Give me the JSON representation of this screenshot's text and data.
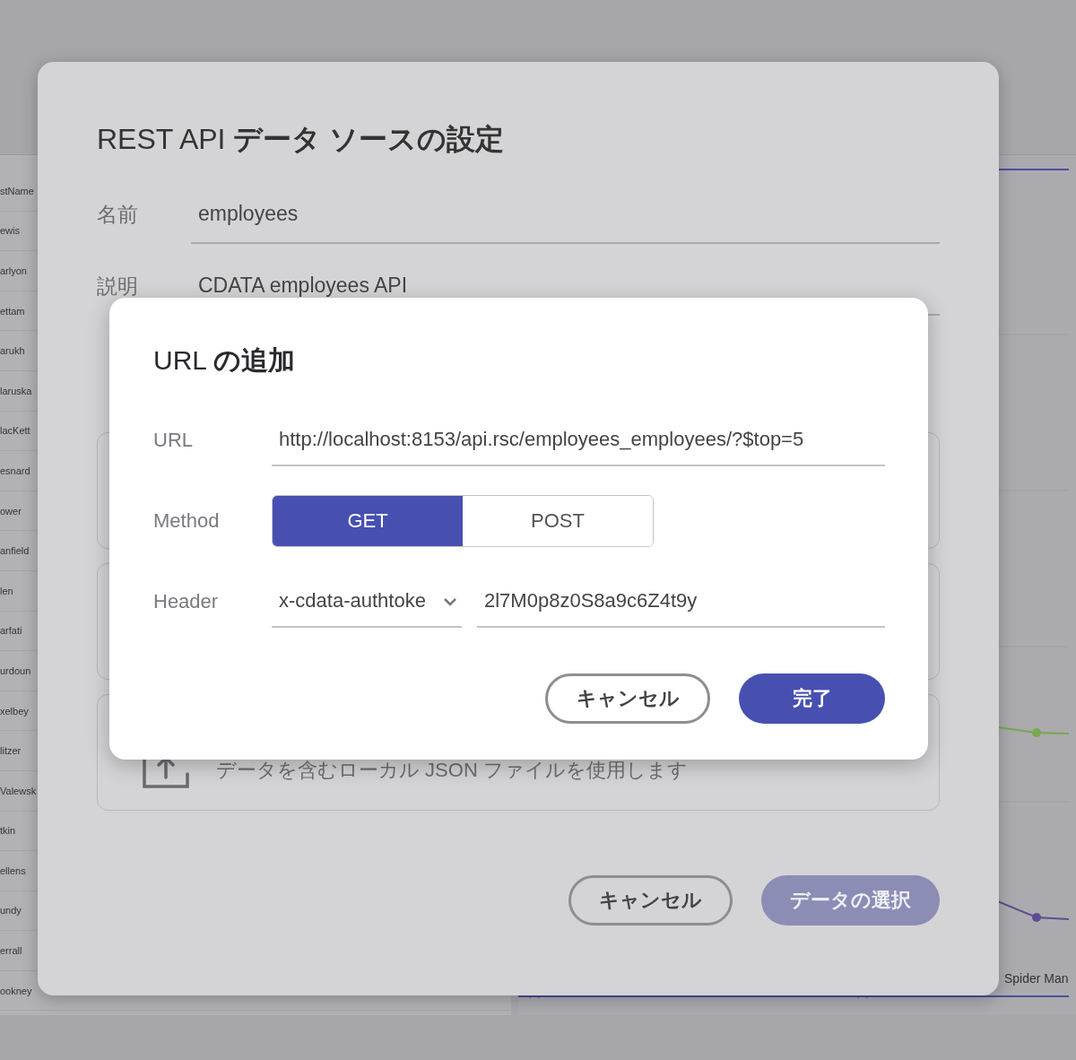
{
  "background_table": {
    "column_header": "stName",
    "rows": [
      "ewis",
      "arlyon",
      "ettam",
      "arukh",
      "laruska",
      "lacKett",
      "esnard",
      "ower",
      "anfield",
      "len",
      "arfati",
      "urdoun",
      "xelbey",
      "litzer",
      "Valewsk",
      "tkin",
      "ellens",
      "undy",
      "errall",
      "ookney"
    ]
  },
  "background_chart": {
    "x_label": "Spider Man"
  },
  "data_source_dialog": {
    "title": "REST API **データ ソースの設定**",
    "fields": [
      {
        "label": "名前",
        "value": "employees"
      },
      {
        "label": "説明",
        "value": "CDATA employees API"
      }
    ],
    "option_cards": [
      {
        "kind": "hidden"
      },
      {
        "kind": "hidden"
      },
      {
        "kind": "upload",
        "text": "データを含むローカル JSON ファイルを使用します"
      }
    ],
    "buttons": [
      {
        "label": "キャンセル",
        "kind": "secondary",
        "disabled": false
      },
      {
        "label": "データの選択",
        "kind": "primary",
        "disabled": true
      }
    ]
  },
  "url_dialog": {
    "title": "URL **の追加**",
    "url": {
      "label": "URL",
      "value": "http://localhost:8153/api.rsc/employees_employees/?$top=5"
    },
    "method": {
      "label": "Method",
      "options": [
        {
          "label": "GET",
          "selected": true
        },
        {
          "label": "POST",
          "selected": false
        }
      ]
    },
    "header": {
      "label": "Header",
      "name": "x-cdata-authtoke",
      "value": "2l7M0p8z0S8a9c6Z4t9y"
    },
    "buttons": [
      {
        "label": "キャンセル",
        "kind": "secondary",
        "disabled": false
      },
      {
        "label": "完了",
        "kind": "primary",
        "disabled": false
      }
    ]
  }
}
